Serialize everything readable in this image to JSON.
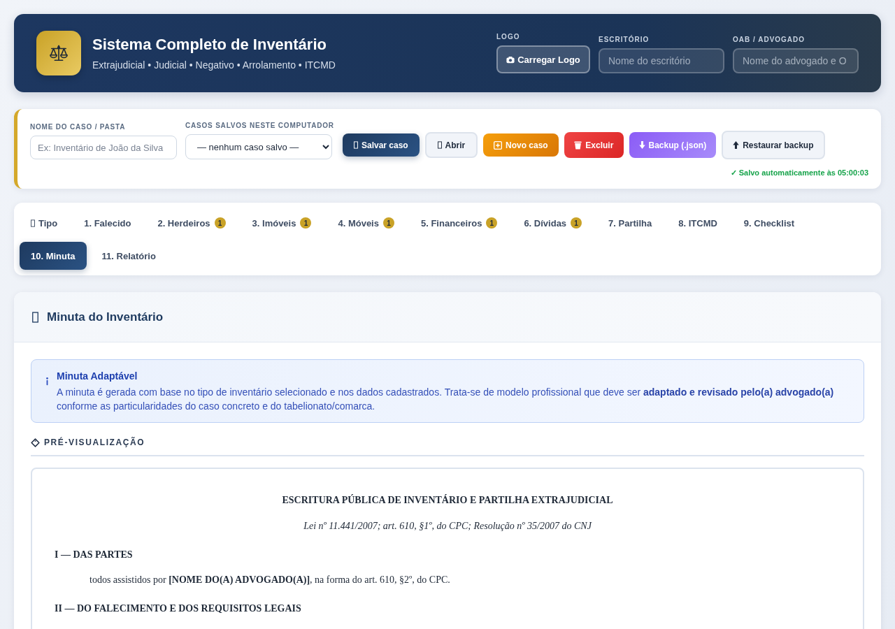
{
  "header": {
    "title": "Sistema Completo de Inventário",
    "subtitle": "Extrajudicial • Judicial • Negativo • Arrolamento • ITCMD",
    "logo": {
      "label": "LOGO",
      "button": "Carregar Logo"
    },
    "fields": [
      {
        "label": "ESCRITÓRIO",
        "placeholder": "Nome do escritório"
      },
      {
        "label": "OAB / ADVOGADO",
        "placeholder": "Nome do advogado e O"
      }
    ]
  },
  "case_bar": {
    "name_field": {
      "label": "NOME DO CASO / PASTA",
      "placeholder": "Ex: Inventário de João da Silva"
    },
    "saved_cases": {
      "label": "CASOS SALVOS NESTE COMPUTADOR",
      "value": "— nenhum caso salvo —"
    },
    "buttons": [
      {
        "label": "Salvar caso",
        "kind": "save"
      },
      {
        "label": "Abrir",
        "kind": "open"
      },
      {
        "label": "Novo caso",
        "kind": "new"
      },
      {
        "label": "Excluir",
        "kind": "delete"
      },
      {
        "label": "Backup (.json)",
        "kind": "backup"
      },
      {
        "label": "Restaurar backup",
        "kind": "restore"
      }
    ],
    "autosave_status": "✓ Salvo automaticamente às 05:00:03"
  },
  "tabs": [
    {
      "label": "Tipo",
      "icon": true,
      "selected": false
    },
    {
      "label": "1. Falecido",
      "selected": false
    },
    {
      "label": "2. Herdeiros",
      "badge": "1",
      "selected": false
    },
    {
      "label": "3. Imóveis",
      "badge": "1",
      "selected": false
    },
    {
      "label": "4. Móveis",
      "badge": "1",
      "selected": false
    },
    {
      "label": "5. Financeiros",
      "badge": "1",
      "selected": false
    },
    {
      "label": "6. Dívidas",
      "badge": "1",
      "selected": false
    },
    {
      "label": "7. Partilha",
      "selected": false
    },
    {
      "label": "8. ITCMD",
      "selected": false
    },
    {
      "label": "9. Checklist",
      "selected": false
    },
    {
      "label": "10. Minuta",
      "selected": true
    },
    {
      "label": "11. Relatório",
      "selected": false
    }
  ],
  "section": {
    "title": "Minuta do Inventário",
    "notice": {
      "title": "Minuta Adaptável",
      "text": "A minuta é gerada com base no tipo de inventário selecionado e nos dados cadastrados. Trata-se de modelo profissional que deve ser **adaptado e revisado pelo(a) advogado(a)** conforme as particularidades do caso concreto e do tabelionato/comarca."
    },
    "preview_heading": "PRÉ-VISUALIZAÇÃO",
    "document": [
      {
        "kind": "title",
        "text": "ESCRITURA PÚBLICA DE INVENTÁRIO E PARTILHA EXTRAJUDICIAL"
      },
      {
        "kind": "subtitle",
        "text": "Lei nº 11.441/2007; art. 610, §1º, do CPC; Resolução nº 35/2007 do CNJ"
      },
      {
        "kind": "heading",
        "text": "I — DAS PARTES"
      },
      {
        "kind": "paragraph",
        "text": "todos assistidos por **[NOME DO(A) ADVOGADO(A)]**, na forma do art. 610, §2º, do CPC."
      },
      {
        "kind": "heading",
        "text": "II — DO FALECIMENTO E DOS REQUISITOS LEGAIS"
      }
    ]
  }
}
